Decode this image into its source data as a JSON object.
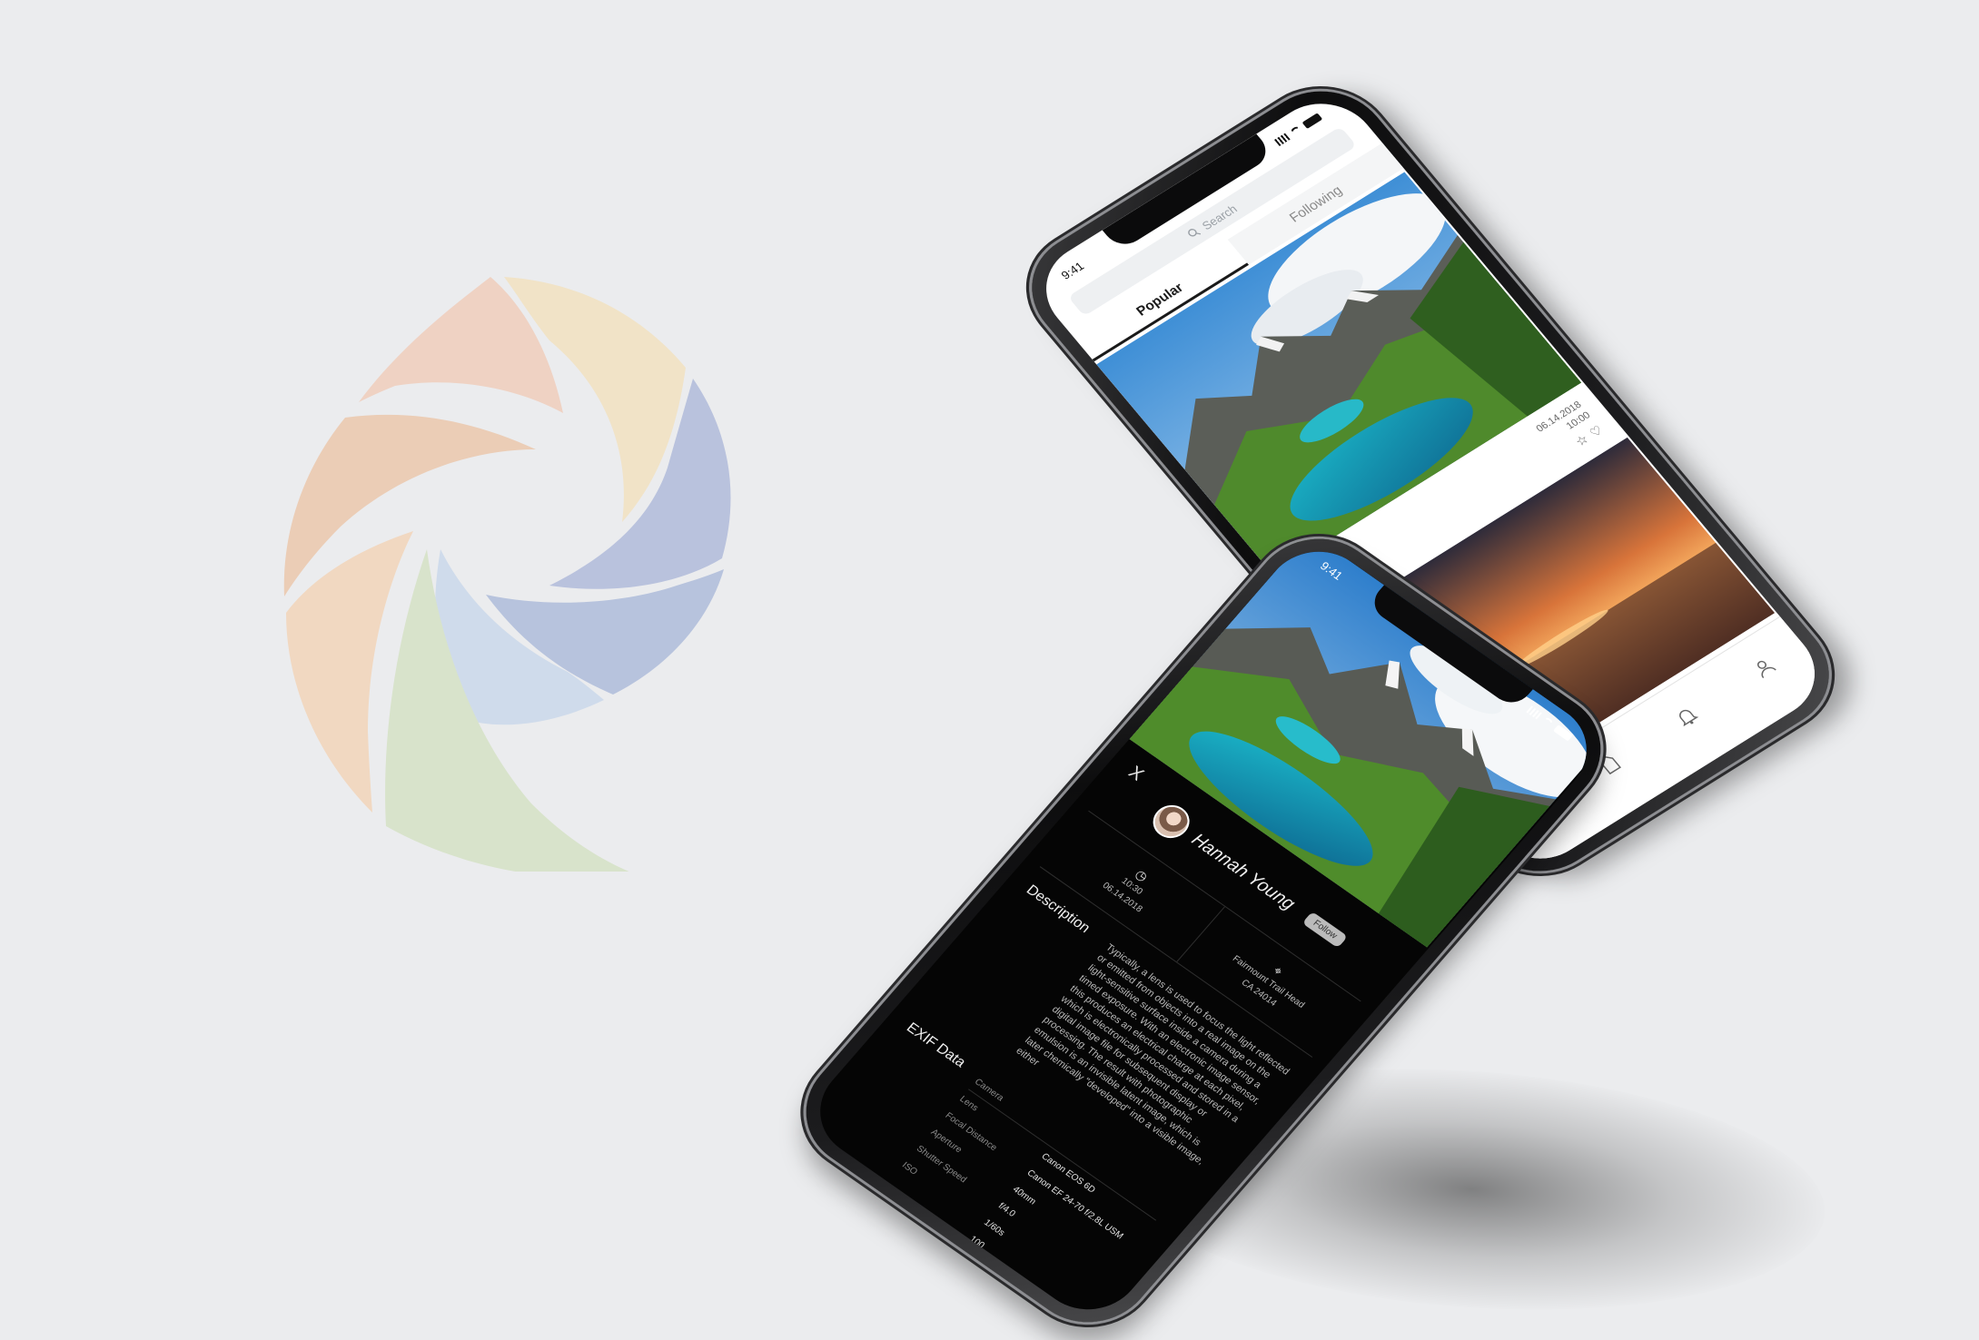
{
  "brand_colors": {
    "background": "#ebecee",
    "aperture_blades": [
      "#f1e3c7",
      "#b9c2dd",
      "#b7c3dd",
      "#cfdbeb",
      "#d8e3cb",
      "#f1d8c1",
      "#ebcdb6",
      "#efd2c3"
    ]
  },
  "feed_screen": {
    "status_time": "9:41",
    "search_placeholder": "Search",
    "tabs": [
      {
        "label": "Popular",
        "active": true
      },
      {
        "label": "Following",
        "active": false
      }
    ],
    "post": {
      "date_line_1": "06.14.2018",
      "date_line_2": "10:00"
    },
    "tabbar_icons": [
      "home-icon",
      "document-icon",
      "bell-icon",
      "user-icon"
    ]
  },
  "detail_screen": {
    "status_time": "9:41",
    "close_label": "X",
    "user_name": "Hannah Young",
    "follow_label": "Follow",
    "time_info": {
      "time": "10:30",
      "date": "06.14.2018"
    },
    "location_info": {
      "line_1": "Fairmount Trail Head",
      "line_2": "CA 24014"
    },
    "description_heading": "Description",
    "description_text": "Typically, a lens is used to focus the light reflected or emitted from objects into a real image on the light-sensitive surface inside a camera during a timed exposure. With an electronic image sensor, this produces an electrical charge at each pixel, which is electronically processed and stored in a digital image file for subsequent display or processing. The result with photographic emulsion is an invisible latent image, which is later chemically \"developed\" into a visible image, either",
    "exif_heading": "EXIF Data",
    "exif_rows": [
      {
        "key": "Camera",
        "value": ""
      },
      {
        "key": "Lens",
        "value": "Canon EOS 6D"
      },
      {
        "key": "Focal Distance",
        "value": "Canon EF 24-70 f/2.8L USM"
      },
      {
        "key": "Aperture",
        "value": "40mm"
      },
      {
        "key": "Shutter Speed",
        "value": "f/4.0"
      },
      {
        "key": "ISO",
        "value": "1/60s"
      },
      {
        "key": "",
        "value": "100"
      }
    ]
  }
}
